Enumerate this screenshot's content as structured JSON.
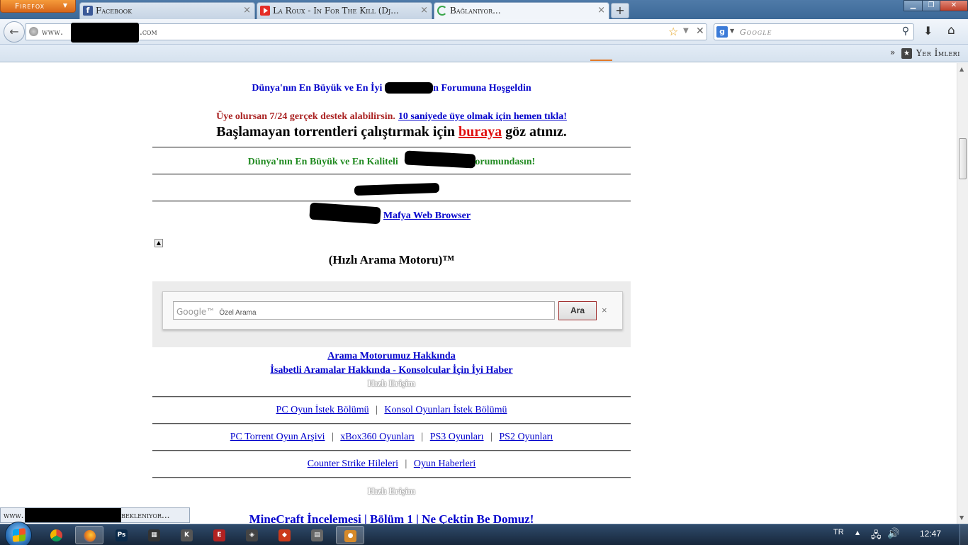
{
  "browser": {
    "app_button": "Firefox",
    "tabs": [
      {
        "label": "Facebook",
        "icon": "facebook-icon",
        "color": "#3b5998"
      },
      {
        "label": "La Roux - In For The Kill (Dj...",
        "icon": "youtube-icon",
        "color": "#e52d27"
      },
      {
        "label": "Bağlanıyor...",
        "icon": "loading-icon",
        "color": "#3aa64a"
      }
    ],
    "new_tab_label": "+",
    "url_prefix": "www.",
    "url_suffix": ".com",
    "search_placeholder": "Google",
    "bookmarks_label": "Yer İmleri"
  },
  "page": {
    "welcome_text": "Dünya'nın En Büyük ve En İyi",
    "welcome_suffix": "un Forumuna Hoşgeldin",
    "member_text": "Üye olursan 7/24 gerçek destek alabilirsin.",
    "member_link": "10 saniyede üye olmak için hemen tıkla!",
    "torrent_prefix": "Başlamayan torrentleri çalıştırmak için",
    "torrent_link": "buraya",
    "torrent_suffix": "göz atınız.",
    "quality_prefix": "Dünya'nın En Büyük ve En Kaliteli",
    "quality_suffix": "Forumundasın!",
    "mafya_link": "Mafya Web Browser",
    "search_heading": "(Hızlı Arama Motoru)™",
    "gcse": {
      "logo": "Google™",
      "placeholder": "Özel Arama",
      "button": "Ara",
      "clear": "×"
    },
    "about_link": "Arama Motorumuz Hakkında",
    "accurate_link": "İsabetli Aramalar Hakkında - Konsolcular İçin İyi Haber",
    "quick_access": "Hızlı Erişim",
    "nav_row_1": [
      "PC Oyun İstek Bölümü",
      "Konsol Oyunları İstek Bölümü"
    ],
    "nav_row_2": [
      "PC Torrent Oyun Arşivi",
      "xBox360 Oyunları",
      "PS3 Oyunları",
      "PS2 Oyunları"
    ],
    "nav_row_3": [
      "Counter Strike Hileleri",
      "Oyun Haberleri"
    ],
    "separator": "|",
    "bottom_link": "MineCraft İncelemesi | Bölüm 1 | Ne Çektin Be Domuz!"
  },
  "status": {
    "prefix": "www.",
    "text": "bekleniyor..."
  },
  "taskbar": {
    "apps": [
      {
        "name": "chrome-icon",
        "color": "#4a90d9",
        "glyph": ""
      },
      {
        "name": "firefox-icon",
        "color": "#e2751c",
        "glyph": ""
      },
      {
        "name": "photoshop-icon",
        "color": "#0a2a4a",
        "glyph": "Ps"
      },
      {
        "name": "app-k-icon",
        "color": "#555555",
        "glyph": "K"
      },
      {
        "name": "clapper-icon",
        "color": "#333333",
        "glyph": "▦"
      },
      {
        "name": "app-red-icon",
        "color": "#b22222",
        "glyph": "E"
      },
      {
        "name": "app-game-icon",
        "color": "#444444",
        "glyph": "◈"
      },
      {
        "name": "app-flame-icon",
        "color": "#cc3a1a",
        "glyph": "◆"
      },
      {
        "name": "calculator-icon",
        "color": "#666666",
        "glyph": "▤"
      },
      {
        "name": "app-orange-icon",
        "color": "#d68a2a",
        "glyph": "●"
      }
    ],
    "language": "TR",
    "clock": "12:47"
  }
}
